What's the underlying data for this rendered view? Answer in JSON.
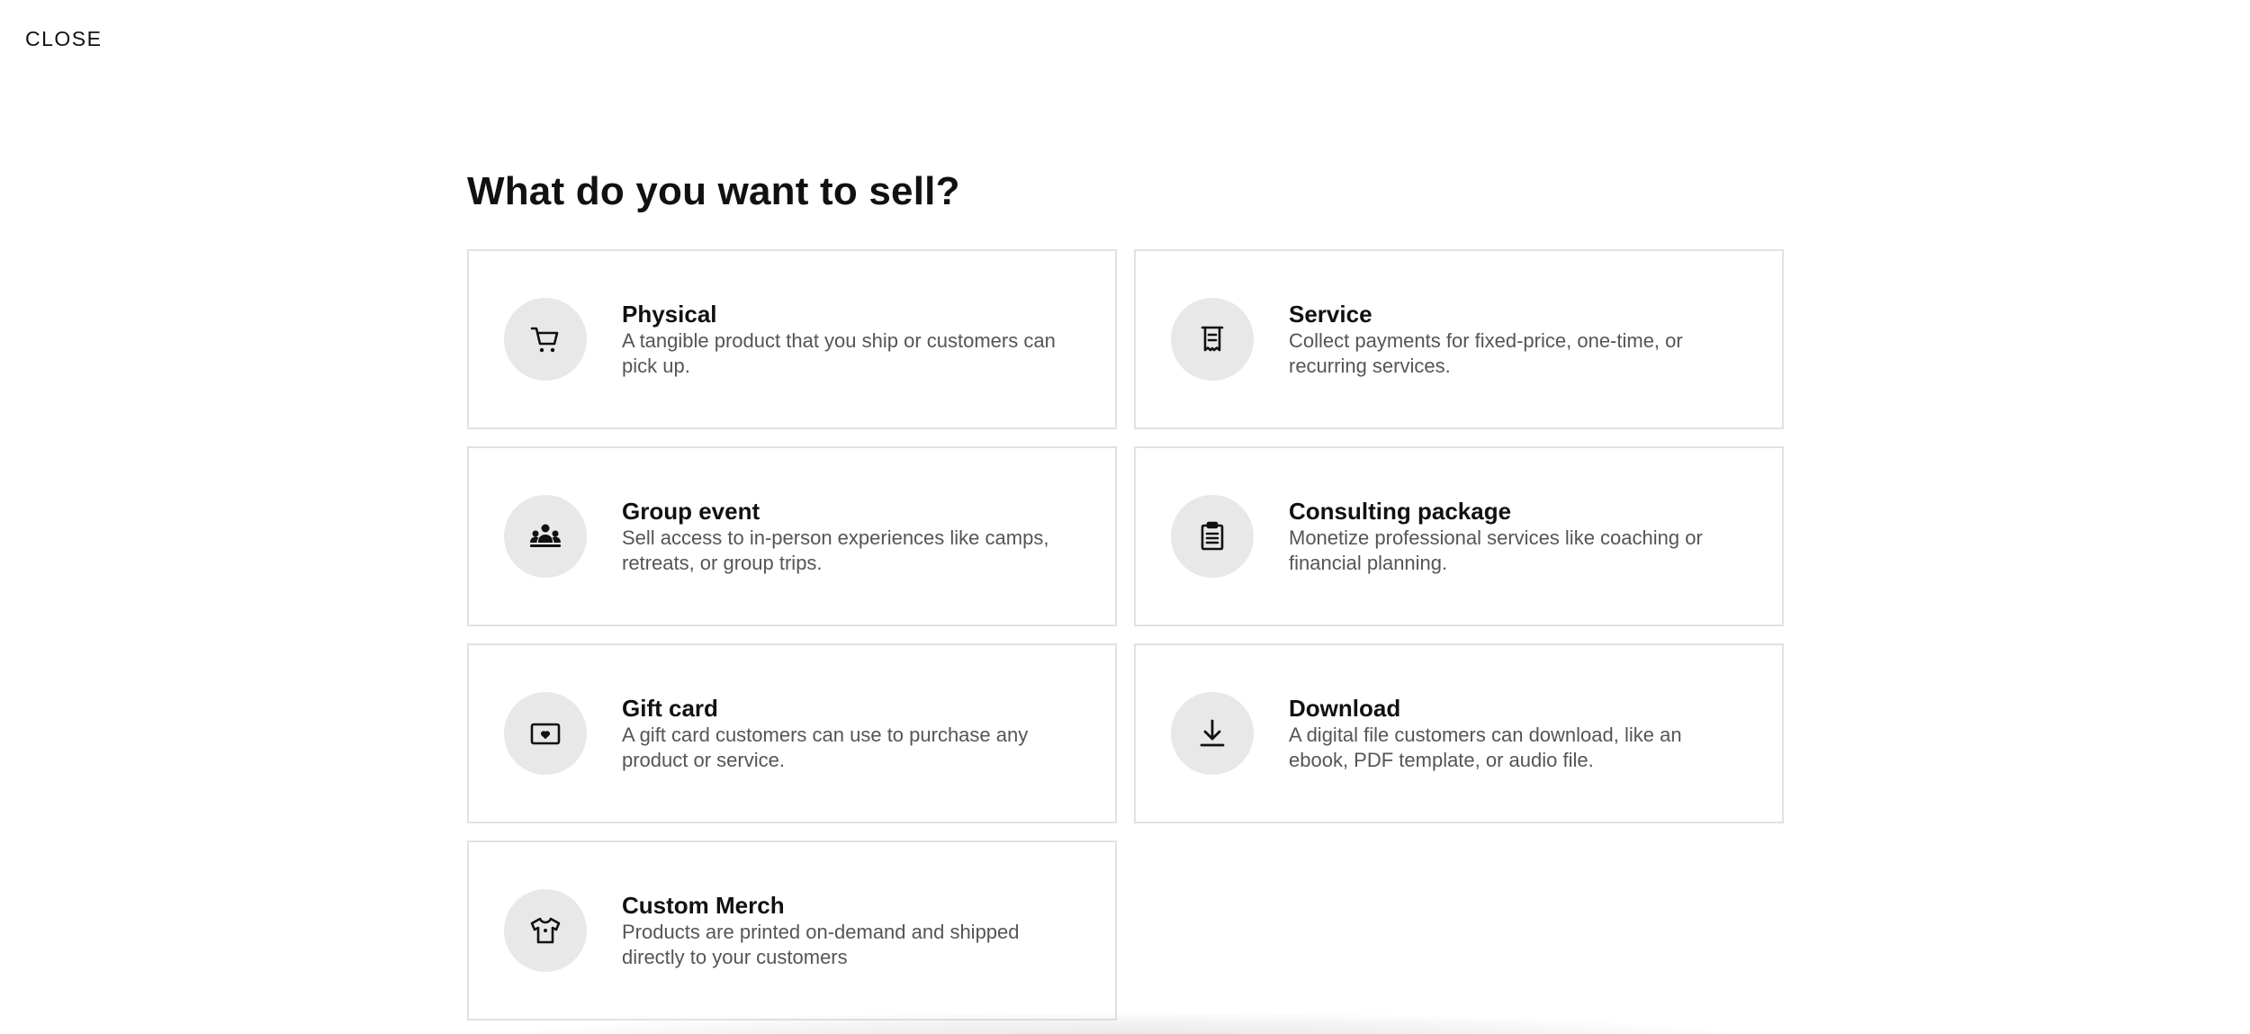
{
  "header": {
    "close_label": "CLOSE"
  },
  "main": {
    "title": "What do you want to sell?",
    "options": [
      {
        "title": "Physical",
        "description": "A tangible product that you ship or customers can pick up.",
        "icon": "shopping-cart-icon"
      },
      {
        "title": "Service",
        "description": "Collect payments for fixed-price, one-time, or recurring services.",
        "icon": "receipt-icon"
      },
      {
        "title": "Group event",
        "description": "Sell access to in-person experiences like camps, retreats, or group trips.",
        "icon": "group-icon"
      },
      {
        "title": "Consulting package",
        "description": "Monetize professional services like coaching or financial planning.",
        "icon": "clipboard-icon"
      },
      {
        "title": "Gift card",
        "description": "A gift card customers can use to purchase any product or service.",
        "icon": "gift-card-icon"
      },
      {
        "title": "Download",
        "description": "A digital file customers can download, like an ebook, PDF template, or audio file.",
        "icon": "download-icon"
      },
      {
        "title": "Custom Merch",
        "description": "Products are printed on-demand and shipped directly to your customers",
        "icon": "tshirt-icon"
      }
    ]
  },
  "colors": {
    "background": "#ffffff",
    "card_border": "#e2e2e2",
    "icon_circle": "#e8e8e8",
    "title_text": "#111111",
    "description_text": "#555555"
  }
}
